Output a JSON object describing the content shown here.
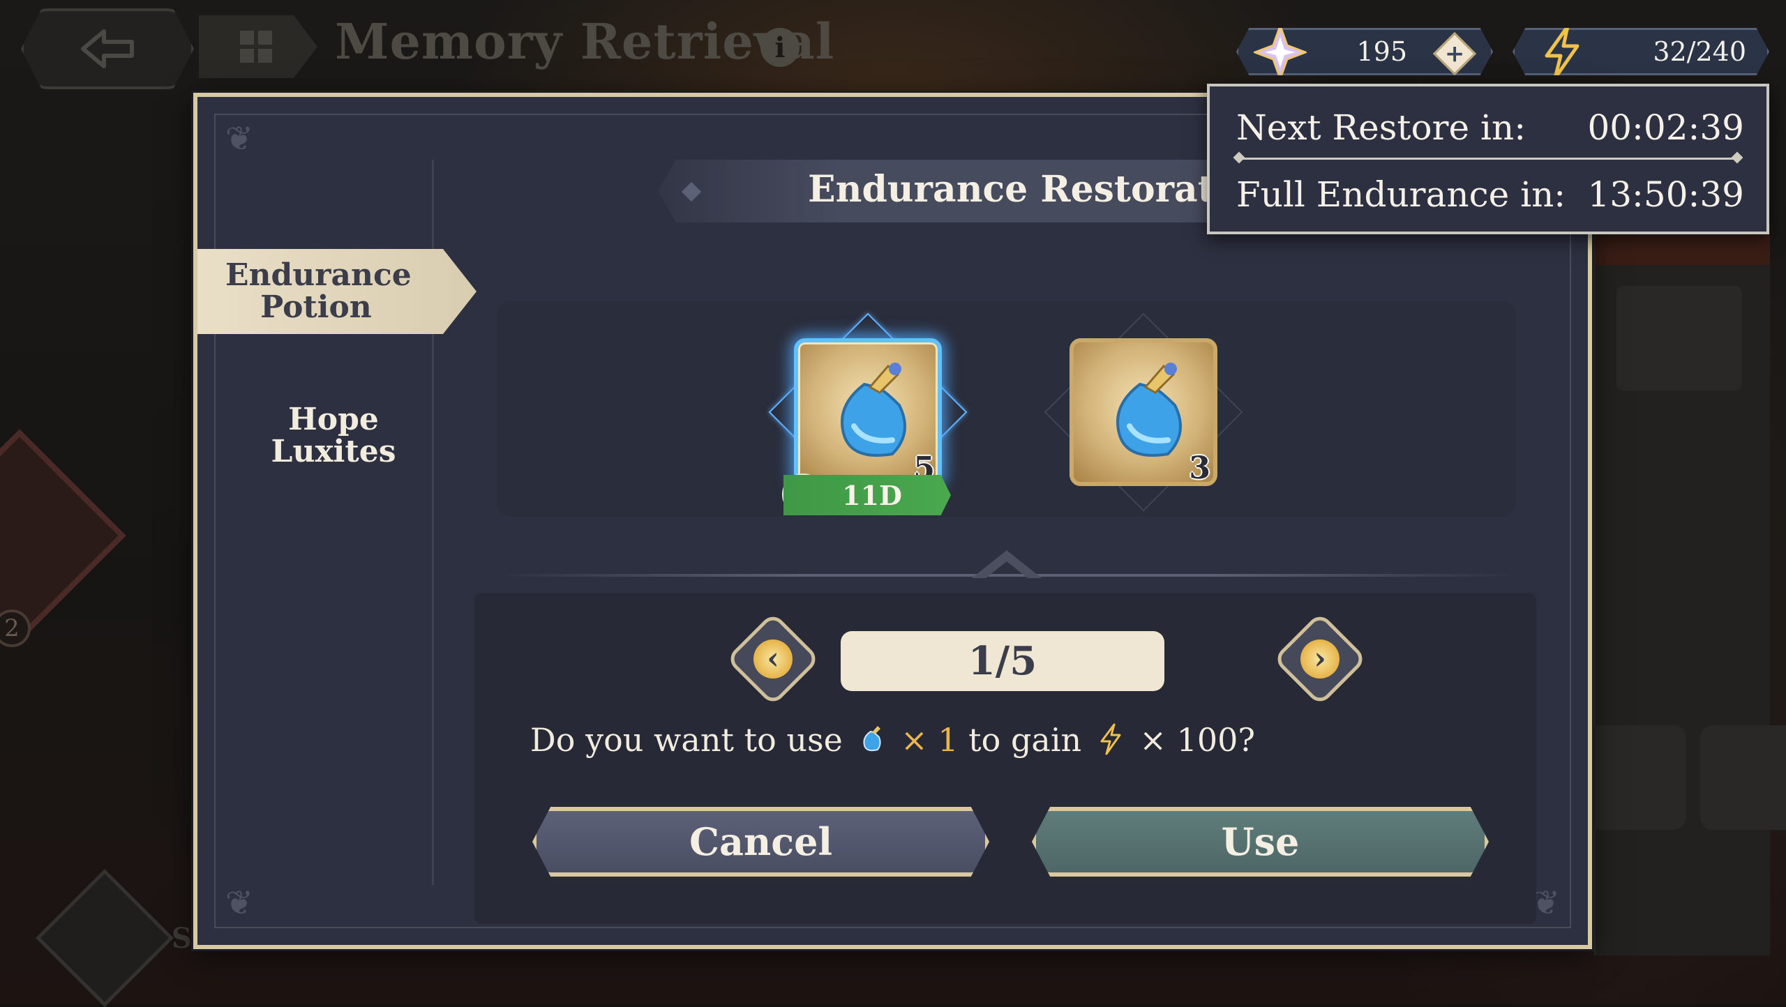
{
  "topbar": {
    "title": "Memory Retrieval",
    "info_glyph": "i"
  },
  "currency": {
    "crystals": "195",
    "endurance": "32/240"
  },
  "tooltip": {
    "next_label": "Next Restore in:",
    "next_value": "00:02:39",
    "full_label": "Full Endurance in:",
    "full_value": "13:50:39"
  },
  "modal": {
    "title": "Endurance Restoration",
    "tabs": [
      {
        "label": "Endurance Potion",
        "active": true
      },
      {
        "label": "Hope Luxites",
        "active": false
      }
    ],
    "items": [
      {
        "name": "endurance-potion",
        "count": "5",
        "selected": true,
        "expiry": "11D"
      },
      {
        "name": "endurance-potion",
        "count": "3",
        "selected": false
      }
    ],
    "quantity": "1/5",
    "prompt": {
      "part1": "Do you want to use",
      "item_multiplier": "× 1",
      "part2": "to gain",
      "gain_multiplier": "× 100?"
    },
    "cancel_label": "Cancel",
    "use_label": "Use"
  },
  "background": {
    "badge_number": "2",
    "bottom_letter": "S"
  },
  "colors": {
    "modal_bg": "#2d3040",
    "frame_gold": "#d7c9a2",
    "selected_glow": "#5fc2ff",
    "expiry_green": "#4aa84f",
    "highlight_orange": "#e9b64a",
    "use_button": "#5f7d7b"
  },
  "icons": [
    "back-arrow-icon",
    "module-icon",
    "info-icon",
    "crystal-icon",
    "add-icon",
    "lightning-icon",
    "potion-icon",
    "clock-icon",
    "chevron-left-icon",
    "chevron-right-icon"
  ]
}
